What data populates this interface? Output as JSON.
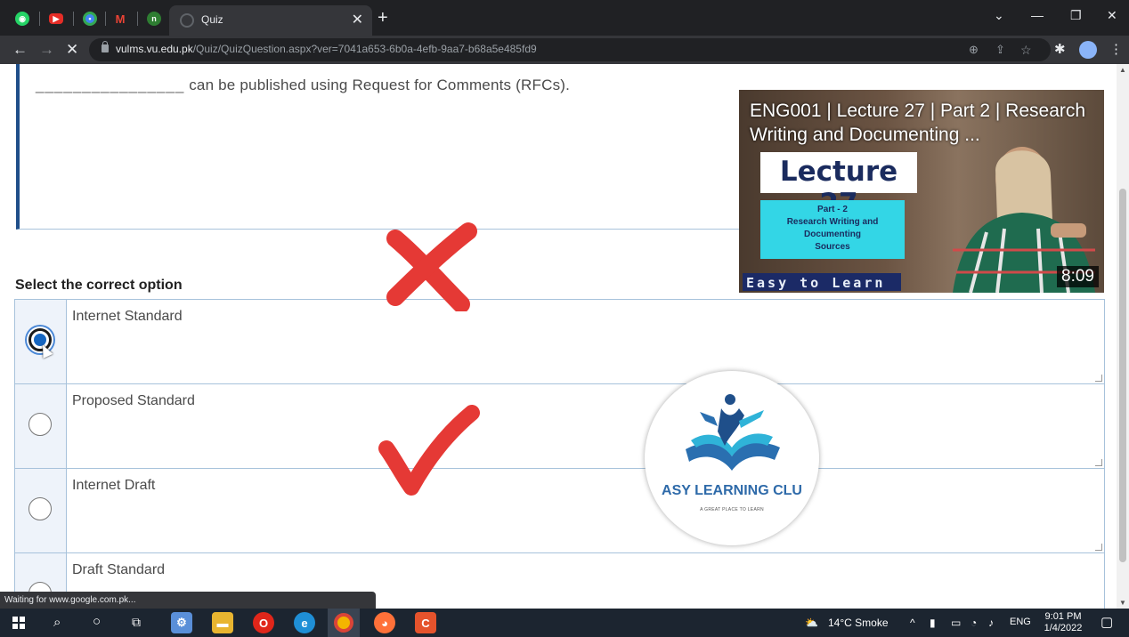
{
  "browser": {
    "tab_title": "Quiz",
    "tab_close": "✕",
    "new_tab": "+",
    "url_host": "vulms.vu.edu.pk",
    "url_path": "/Quiz/QuizQuestion.aspx?ver=7041a653-6b0a-4efb-9aa7-b68a5e485fd9",
    "pinned_tabs": [
      "whatsapp-icon",
      "youtube-icon",
      "chrome-icon",
      "gmail-icon",
      "vu-icon"
    ],
    "status_text": "Waiting for www.google.com.pk..."
  },
  "quiz": {
    "question_blank": "________________",
    "question_text": "can be published using Request for Comments (RFCs).",
    "instruction": "Select the correct option",
    "options": [
      {
        "label": "Internet Standard",
        "selected": true,
        "mark": "wrong"
      },
      {
        "label": "Proposed Standard",
        "selected": false
      },
      {
        "label": "Internet Draft",
        "selected": false,
        "mark": "correct"
      },
      {
        "label": "Draft Standard",
        "selected": false
      }
    ]
  },
  "video": {
    "title": "ENG001 | Lecture 27 | Part 2 | Research Writing and Documenting ...",
    "lecture_label": "Lecture 27",
    "part_text": "Part - 2\nResearch Writing and\nDocumenting\nSources",
    "brand": "Easy to Learn",
    "duration": "8:09"
  },
  "logo": {
    "name": "ASY LEARNING CLU",
    "tagline": "A GREAT PLACE TO LEARN"
  },
  "taskbar": {
    "weather": "14°C  Smoke",
    "language": "ENG",
    "time": "9:01 PM",
    "date": "1/4/2022"
  },
  "colors": {
    "accent_blue": "#1f4f8a",
    "cross_red": "#e53935",
    "check_red": "#e53935",
    "brand_navy": "#1b2a66"
  }
}
